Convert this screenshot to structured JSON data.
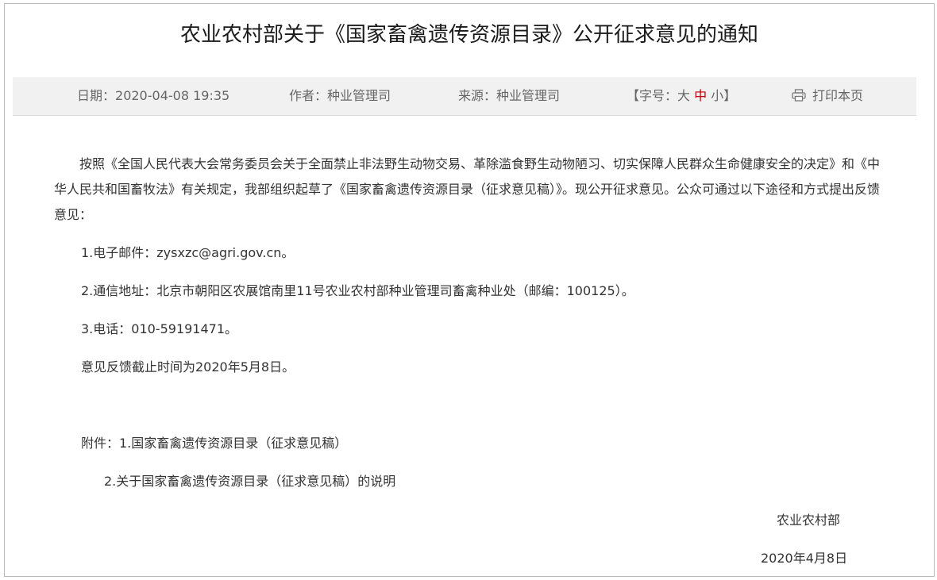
{
  "article": {
    "title": "农业农村部关于《国家畜禽遗传资源目录》公开征求意见的通知"
  },
  "meta": {
    "date_label": "日期：",
    "date_value": "2020-04-08 19:35",
    "author_label": "作者：",
    "author_value": "种业管理司",
    "source_label": "来源：",
    "source_value": "种业管理司",
    "fontsize_prefix": "【字号：",
    "fontsize_large": "大",
    "fontsize_medium": "中",
    "fontsize_small": "小",
    "fontsize_suffix": "】",
    "fontsize_active": "medium",
    "print_label": "打印本页",
    "print_icon": "printer-icon"
  },
  "body": {
    "intro": "按照《全国人民代表大会常务委员会关于全面禁止非法野生动物交易、革除滥食野生动物陋习、切实保障人民群众生命健康安全的决定》和《中华人民共和国畜牧法》有关规定，我部组织起草了《国家畜禽遗传资源目录（征求意见稿）》。现公开征求意见。公众可通过以下途径和方式提出反馈意见：",
    "items": [
      "1.电子邮件：zysxzc@agri.gov.cn。",
      "2.通信地址：北京市朝阳区农展馆南里11号农业农村部种业管理司畜禽种业处（邮编：100125）。",
      "3.电话：010-59191471。"
    ],
    "deadline": "意见反馈截止时间为2020年5月8日。",
    "attachment_1": "附件：1.国家畜禽遗传资源目录（征求意见稿）",
    "attachment_2": "2.关于国家畜禽遗传资源目录（征求意见稿）的说明"
  },
  "signature": {
    "org": "农业农村部",
    "date": "2020年4月8日"
  },
  "colors": {
    "meta_bar_bg": "#f1f1f1",
    "active_fontsize": "#c00000",
    "border": "#b9b9b9"
  }
}
